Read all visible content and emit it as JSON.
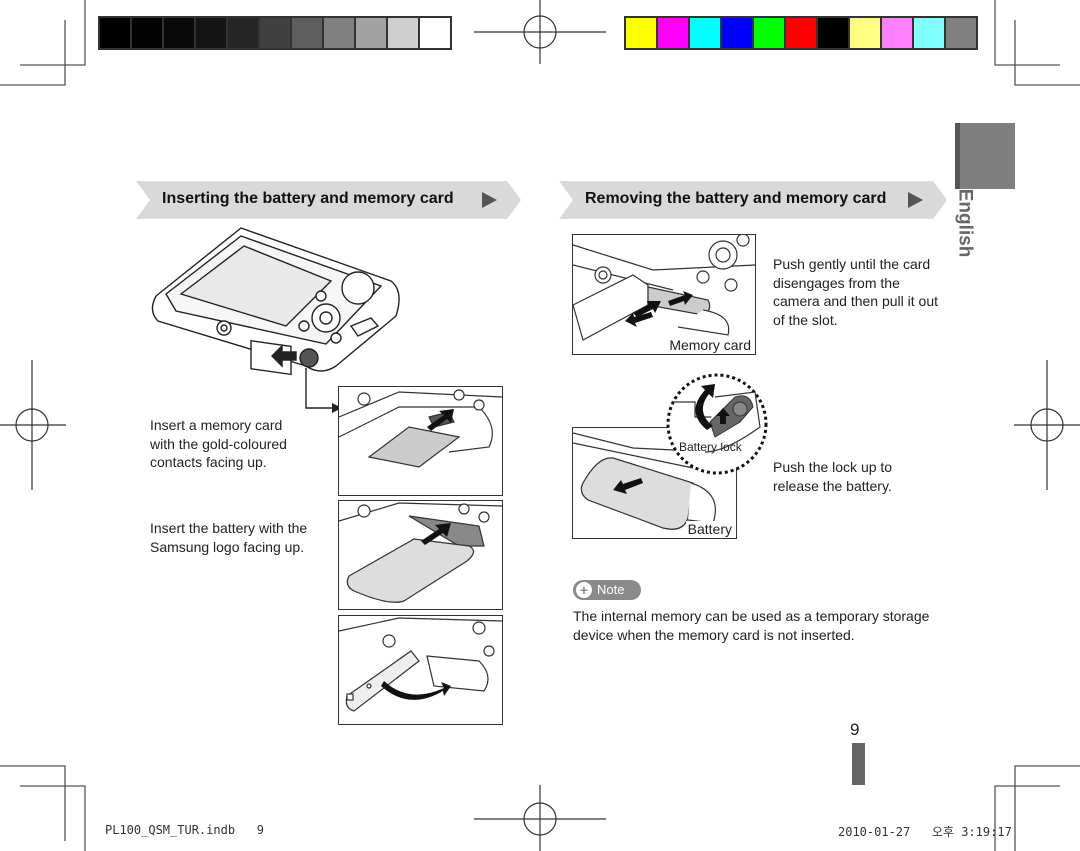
{
  "colors": {
    "grayscale_bar": [
      "#000000",
      "#030303",
      "#0a0a0a",
      "#141414",
      "#262626",
      "#404040",
      "#5e5e5e",
      "#808080",
      "#a2a2a2",
      "#cfcfcf",
      "#ffffff"
    ],
    "color_bar": [
      "#ffff00",
      "#ff00ff",
      "#00ffff",
      "#0000ff",
      "#00ff00",
      "#ff0000",
      "#000000",
      "#ffff80",
      "#ff80ff",
      "#80ffff",
      "#808080"
    ],
    "header_bg": "#d9d9d9",
    "language_tab": "#7f7f7f",
    "note_badge": "#8a8a8a",
    "page_bar": "#666666"
  },
  "sidebar": {
    "language": "English"
  },
  "inserting": {
    "title": "Inserting the battery and memory card",
    "step_memory_card": "Insert a memory card with the gold-coloured contacts facing up.",
    "step_battery": "Insert the battery with the Samsung logo facing up."
  },
  "removing": {
    "title": "Removing the battery and memory card",
    "memory_card_label": "Memory card",
    "memory_card_text": "Push gently until the card disengages from the camera and then pull it out of the slot.",
    "battery_lock_label": "Battery lock",
    "battery_label": "Battery",
    "battery_text": "Push the lock up to release the battery."
  },
  "note": {
    "label": "Note",
    "text": "The internal memory can be used as a temporary storage device when the memory card is not inserted."
  },
  "page": {
    "number": "9"
  },
  "footer": {
    "file": "PL100_QSM_TUR.indb   9",
    "timestamp": "2010-01-27   오후 3:19:17"
  }
}
